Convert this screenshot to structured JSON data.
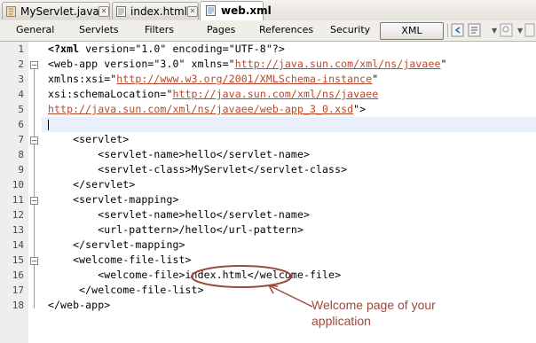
{
  "file_tabs": [
    {
      "label": "MyServlet.java",
      "active": false
    },
    {
      "label": "index.html",
      "active": false
    },
    {
      "label": "web.xml",
      "active": true
    }
  ],
  "view_tabs": [
    "General",
    "Servlets",
    "Filters",
    "Pages",
    "References",
    "Security",
    "XML"
  ],
  "active_view": "XML",
  "line_numbers": [
    "1",
    "2",
    "3",
    "4",
    "5",
    "6",
    "7",
    "8",
    "9",
    "10",
    "11",
    "12",
    "13",
    "14",
    "15",
    "16",
    "17",
    "18"
  ],
  "code": {
    "l1a": "<?xml",
    "l1b": " version=\"1.0\" encoding=\"UTF-8\"?>",
    "l2a": "<web-app version=\"3.0\" xmlns=\"",
    "l2b": "http://java.sun.com/xml/ns/javaee",
    "l2c": "\"",
    "l3a": "xmlns:xsi=\"",
    "l3b": "http://www.w3.org/2001/XMLSchema-instance",
    "l3c": "\"",
    "l4a": "xsi:schemaLocation=\"",
    "l4b": "http://java.sun.com/xml/ns/javaee",
    "l5a": "http://java.sun.com/xml/ns/javaee/web-app_3_0.xsd",
    "l5b": "\">",
    "l8": "    <servlet>",
    "l9": "        <servlet-name>hello</servlet-name>",
    "l10": "        <servlet-class>MyServlet</servlet-class>",
    "l11": "    </servlet>",
    "l12": "    <servlet-mapping>",
    "l13": "        <servlet-name>hello</servlet-name>",
    "l14": "        <url-pattern>/hello</url-pattern>",
    "l15": "    </servlet-mapping>",
    "l16": "    <welcome-file-list>",
    "l17": "        <welcome-file>index.html</welcome-file>",
    "l18": "     </welcome-file-list>",
    "l19": "</web-app>"
  },
  "annotation": "Welcome page of your application",
  "colors": {
    "annotation": "#9a4a3e",
    "string": "#b9472b"
  },
  "icons": [
    "java-file-icon",
    "html-file-icon",
    "xml-file-icon",
    "close-icon",
    "back-icon",
    "forward-icon",
    "history-icon",
    "search-icon",
    "dropdown-arrow-icon",
    "collapse-icon"
  ]
}
